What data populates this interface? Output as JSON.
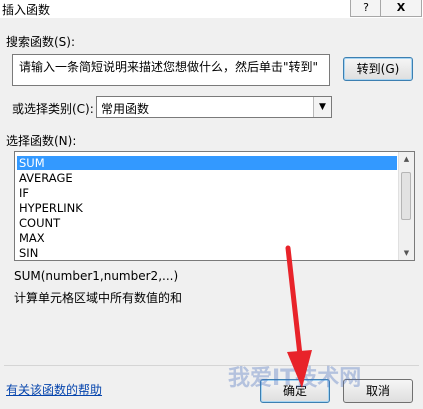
{
  "dialog": {
    "title": "插入函数",
    "help_button": "?",
    "close_button": "X"
  },
  "search": {
    "label": "搜索函数(S):",
    "placeholder": "请输入一条简短说明来描述您想做什么，然后单击\"转到\"",
    "go_button": "转到(G)"
  },
  "category": {
    "label": "或选择类别(C):",
    "selected": "常用函数"
  },
  "functions": {
    "label": "选择函数(N):",
    "items": [
      "SUM",
      "AVERAGE",
      "IF",
      "HYPERLINK",
      "COUNT",
      "MAX",
      "SIN"
    ],
    "selected_index": 0
  },
  "description": {
    "signature": "SUM(number1,number2,...)",
    "text": "计算单元格区域中所有数值的和"
  },
  "footer": {
    "help_link": "有关该函数的帮助",
    "ok_button": "确定",
    "cancel_button": "取消"
  },
  "watermark": "我爱IT技术网",
  "colors": {
    "selection": "#3399ff",
    "arrow": "#e8232a",
    "link": "#0645ad"
  }
}
